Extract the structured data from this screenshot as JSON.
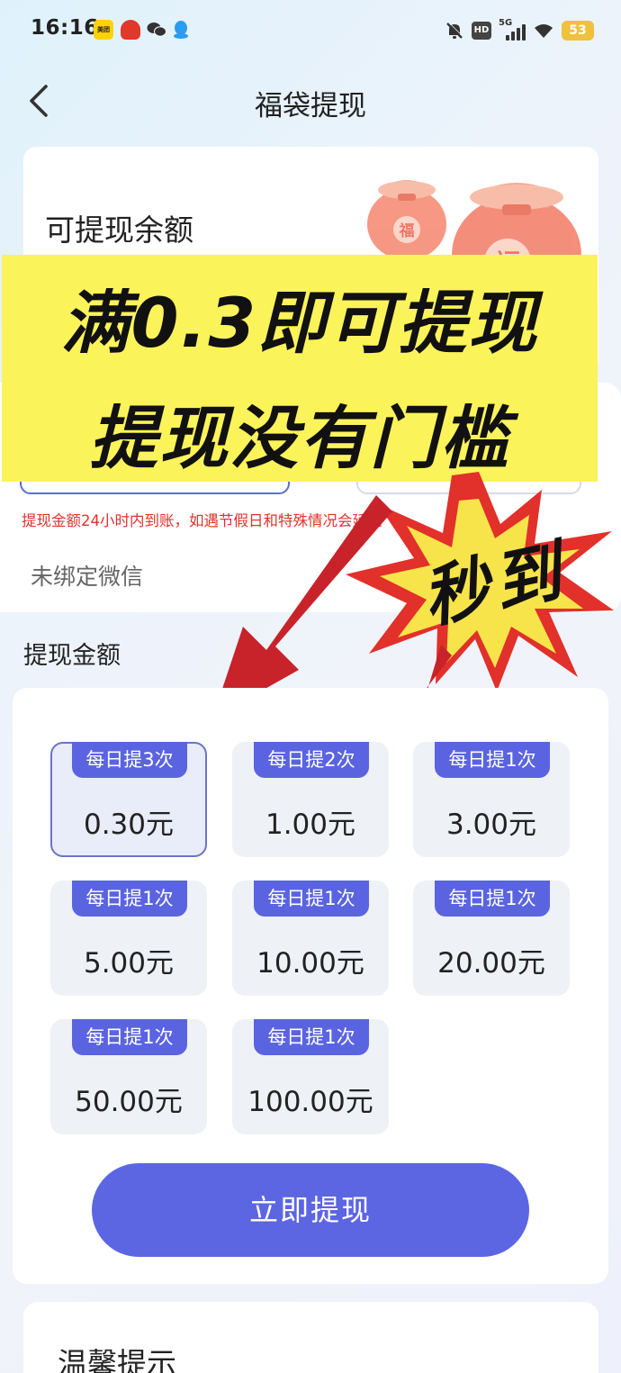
{
  "status_bar": {
    "time": "16:16",
    "meituan_label": "美团",
    "network": "5G",
    "hd": "HD",
    "battery": "53"
  },
  "header": {
    "title": "福袋提现"
  },
  "balance": {
    "label": "可提现余额",
    "bag_char": "福"
  },
  "account": {
    "note": "提现金额24小时内到账，如遇节假日和特殊情况会延迟",
    "unbound": "未绑定微信"
  },
  "overlay": {
    "line1": "满0.3即可提现",
    "line2": "提现没有门槛",
    "burst": "秒到",
    "colors": {
      "banner": "#fbf35a",
      "burst": "#e2302a",
      "burst_inner": "#f7e44a",
      "arrow": "#c8232a"
    }
  },
  "withdraw": {
    "section_title": "提现金额",
    "options": [
      {
        "tag": "每日提3次",
        "amount": "0.30元",
        "selected": true
      },
      {
        "tag": "每日提2次",
        "amount": "1.00元",
        "selected": false
      },
      {
        "tag": "每日提1次",
        "amount": "3.00元",
        "selected": false
      },
      {
        "tag": "每日提1次",
        "amount": "5.00元",
        "selected": false
      },
      {
        "tag": "每日提1次",
        "amount": "10.00元",
        "selected": false
      },
      {
        "tag": "每日提1次",
        "amount": "20.00元",
        "selected": false
      },
      {
        "tag": "每日提1次",
        "amount": "50.00元",
        "selected": false
      },
      {
        "tag": "每日提1次",
        "amount": "100.00元",
        "selected": false
      }
    ],
    "submit_label": "立即提现",
    "accent_color": "#5c66e3"
  },
  "tips": {
    "title": "温馨提示"
  },
  "icons": [
    "back-chevron-icon",
    "mute-bell-icon",
    "wifi-icon",
    "signal-icon",
    "wechat-icon",
    "qq-icon",
    "lucky-bag-icon"
  ]
}
